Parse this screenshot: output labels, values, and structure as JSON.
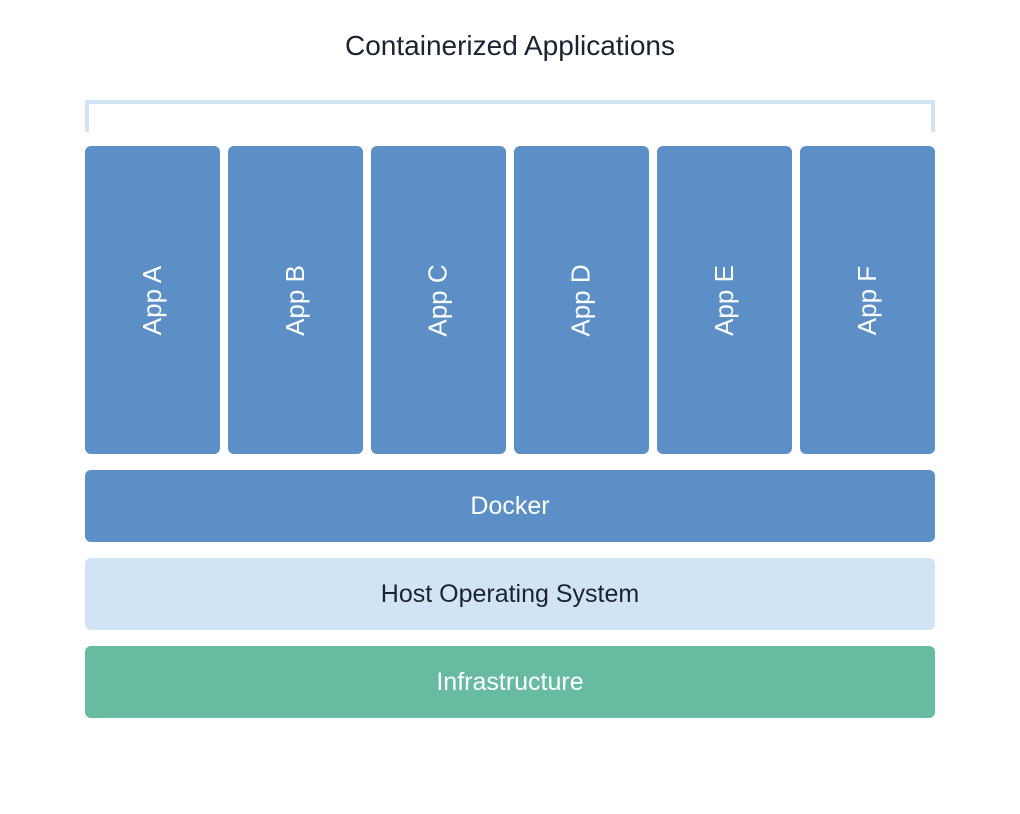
{
  "title": "Containerized Applications",
  "apps": [
    {
      "label": "App A"
    },
    {
      "label": "App B"
    },
    {
      "label": "App C"
    },
    {
      "label": "App D"
    },
    {
      "label": "App E"
    },
    {
      "label": "App F"
    }
  ],
  "layers": {
    "docker": "Docker",
    "host": "Host Operating System",
    "infrastructure": "Infrastructure"
  },
  "colors": {
    "app_box": "#5b8fc5",
    "docker": "#5b8fc5",
    "host": "#d0e4f5",
    "infrastructure": "#67bba0",
    "text_dark": "#1a2332",
    "text_light": "#ffffff"
  }
}
